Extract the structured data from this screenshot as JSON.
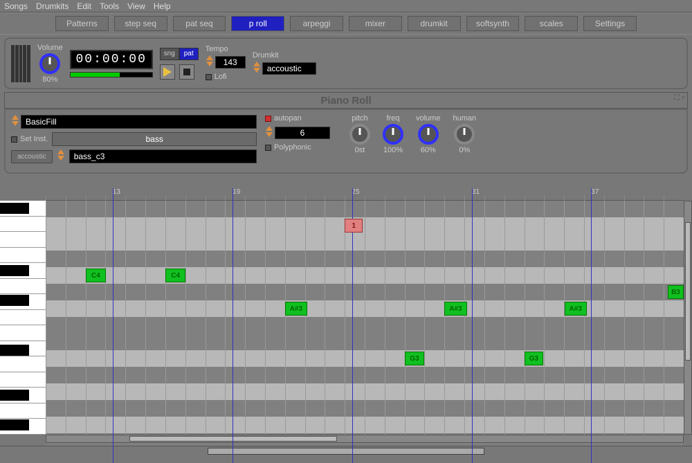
{
  "menubar": [
    "Songs",
    "Drumkits",
    "Edit",
    "Tools",
    "View",
    "Help"
  ],
  "tabs": [
    {
      "label": "Patterns",
      "active": false
    },
    {
      "label": "step seq",
      "active": false
    },
    {
      "label": "pat seq",
      "active": false
    },
    {
      "label": "p roll",
      "active": true
    },
    {
      "label": "arpeggi",
      "active": false
    },
    {
      "label": "mixer",
      "active": false
    },
    {
      "label": "drumkit",
      "active": false
    },
    {
      "label": "softsynth",
      "active": false
    },
    {
      "label": "scales",
      "active": false
    },
    {
      "label": "Settings",
      "active": false
    }
  ],
  "transport": {
    "volume_label": "Volume",
    "volume_value": "80%",
    "timecode": "00:00:00",
    "sng_label": "sng",
    "pat_label": "pat",
    "tempo_label": "Tempo",
    "tempo_value": "143",
    "drumkit_label": "Drumkit",
    "drumkit_value": "accoustic",
    "lofi_label": "Lofi"
  },
  "pianoroll": {
    "title": "Piano Roll",
    "pattern_name": "BasicFill",
    "set_inst_label": "Set Inst.",
    "inst_group": "bass",
    "inst_button": "accoustic",
    "inst_sample": "bass_c3",
    "autopan_label": "autopan",
    "voices_value": "6",
    "polyphonic_label": "Polyphonic",
    "knobs": [
      {
        "label": "pitch",
        "value": "0st",
        "fill": "gray"
      },
      {
        "label": "freq",
        "value": "100%",
        "fill": "blue"
      },
      {
        "label": "volume",
        "value": "60%",
        "fill": "blue"
      },
      {
        "label": "human",
        "value": "0%",
        "fill": "gray"
      }
    ],
    "ruler_marks": [
      {
        "pos": 0.105,
        "label": "13"
      },
      {
        "pos": 0.293,
        "label": "19"
      },
      {
        "pos": 0.48,
        "label": "25"
      },
      {
        "pos": 0.668,
        "label": "31"
      },
      {
        "pos": 0.855,
        "label": "37"
      }
    ],
    "notes": [
      {
        "label": "1",
        "row": 1,
        "x": 0.469,
        "w": 0.028,
        "red": true
      },
      {
        "label": "C4",
        "row": 4,
        "x": 0.063,
        "w": 0.031
      },
      {
        "label": "C4",
        "row": 4,
        "x": 0.188,
        "w": 0.031
      },
      {
        "label": "B3",
        "row": 5,
        "x": 0.975,
        "w": 0.025
      },
      {
        "label": "A#3",
        "row": 6,
        "x": 0.375,
        "w": 0.035
      },
      {
        "label": "A#3",
        "row": 6,
        "x": 0.625,
        "w": 0.035
      },
      {
        "label": "A#3",
        "row": 6,
        "x": 0.813,
        "w": 0.035
      },
      {
        "label": "G3",
        "row": 9,
        "x": 0.563,
        "w": 0.03
      },
      {
        "label": "G3",
        "row": 9,
        "x": 0.75,
        "w": 0.03
      }
    ]
  }
}
